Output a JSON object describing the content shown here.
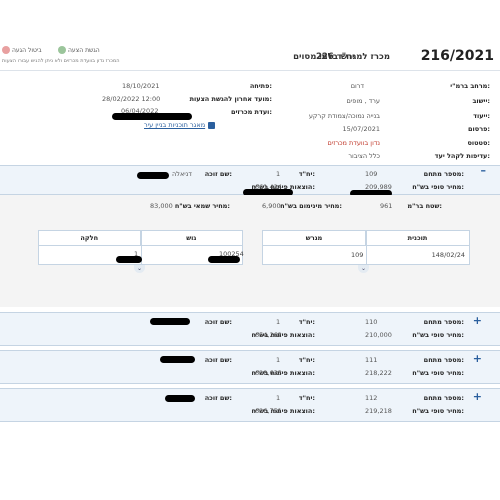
{
  "header": {
    "tender_no": "216/2021",
    "title": "מכרז למגרש בלתי מסוים",
    "units": "226 יח\"ד",
    "submit_label": "הגשת הצעה",
    "cancel_label": "ביטול הגעה",
    "note": "המכרז נדון בוועדת מכרזים ולא ניתן להגיש עבורו הצעות"
  },
  "details_right": [
    {
      "label": "מרחב ברמ\"י:",
      "value": "דרום"
    },
    {
      "label": "יישוב:",
      "value": "ערד , מופים"
    },
    {
      "label": "ייעוד:",
      "value": "בנייה נמוכה/צמודת קרקע"
    },
    {
      "label": "פרסום:",
      "value": "15/07/2021"
    },
    {
      "label": "סטטוס:",
      "value": "נדון בוועדת מכרזים"
    },
    {
      "label": "עדיפות לקהל יעד:",
      "value": "כלל הציבור"
    }
  ],
  "details_left": [
    {
      "label": "פתיחה:",
      "value": "18/10/2021"
    },
    {
      "label": "מועד אחרון להגשת הצעות:",
      "value": "28/02/2022 12:00"
    },
    {
      "label": "ועדת מכרזים:",
      "value": "06/04/2022"
    }
  ],
  "plan_link": "מאגר תוכניות בניין עיר",
  "lots": [
    {
      "no": "109",
      "units": "1",
      "winner": "דניאלה",
      "price": "209,989",
      "dev_cost": "661,424",
      "expanded": true,
      "area": "961",
      "min_price": "6,900",
      "appraised": "83,000",
      "plan": "148/02/24",
      "parcel_no": "109",
      "block": "100254",
      "part": "1"
    },
    {
      "no": "110",
      "units": "1",
      "winner": "",
      "price": "210,000",
      "dev_cost": "654,262",
      "expanded": false
    },
    {
      "no": "111",
      "units": "1",
      "winner": "",
      "price": "218,222",
      "dev_cost": "628,633",
      "expanded": false
    },
    {
      "no": "112",
      "units": "1",
      "winner": "",
      "price": "219,218",
      "dev_cost": "626,751",
      "expanded": false
    }
  ],
  "labels": {
    "lot_no": "מספר מתחם:",
    "units": "יח\"ד:",
    "winner": "שם זוכה:",
    "final_price": "מחיר סופי בש\"ח:",
    "dev_cost": "הוצאות פיתוח בש\"ח:",
    "area": "שטח בר\"מ:",
    "min_price": "מחיר מינימום בש\"ח:",
    "appraised": "מחיר שמאי בש\"ח:",
    "plan": "תוכנית",
    "parcel": "מגרש",
    "block": "גוש",
    "part": "חלקה"
  },
  "colors": {
    "accent": "#2a5f9e",
    "status": "#c0392b",
    "panel": "#eef4fa"
  }
}
